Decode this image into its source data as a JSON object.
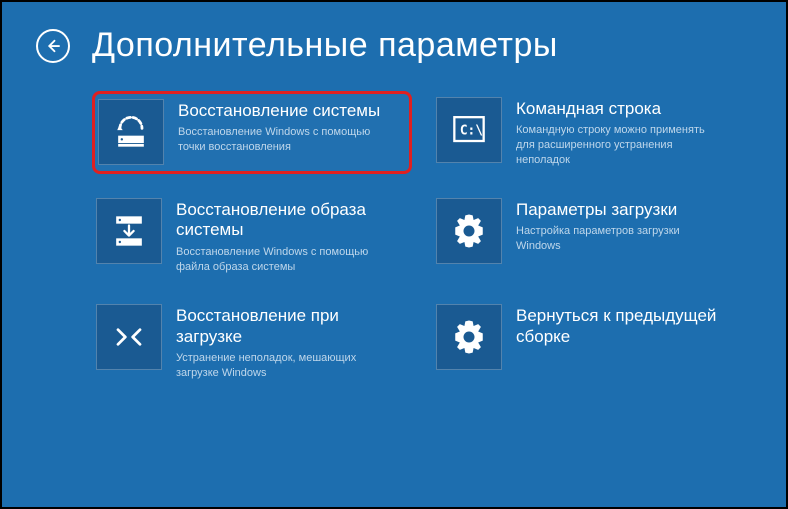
{
  "header": {
    "title": "Дополнительные параметры"
  },
  "tiles": [
    {
      "title": "Восстановление системы",
      "desc": "Восстановление Windows с помощью точки восстановления"
    },
    {
      "title": "Командная строка",
      "desc": "Командную строку можно применять для расширенного устранения неполадок"
    },
    {
      "title": "Восстановление образа системы",
      "desc": "Восстановление Windows с помощью файла образа системы"
    },
    {
      "title": "Параметры загрузки",
      "desc": "Настройка параметров загрузки Windows"
    },
    {
      "title": "Восстановление при загрузке",
      "desc": "Устранение неполадок, мешающих загрузке Windows"
    },
    {
      "title": "Вернуться к предыдущей сборке",
      "desc": ""
    }
  ]
}
